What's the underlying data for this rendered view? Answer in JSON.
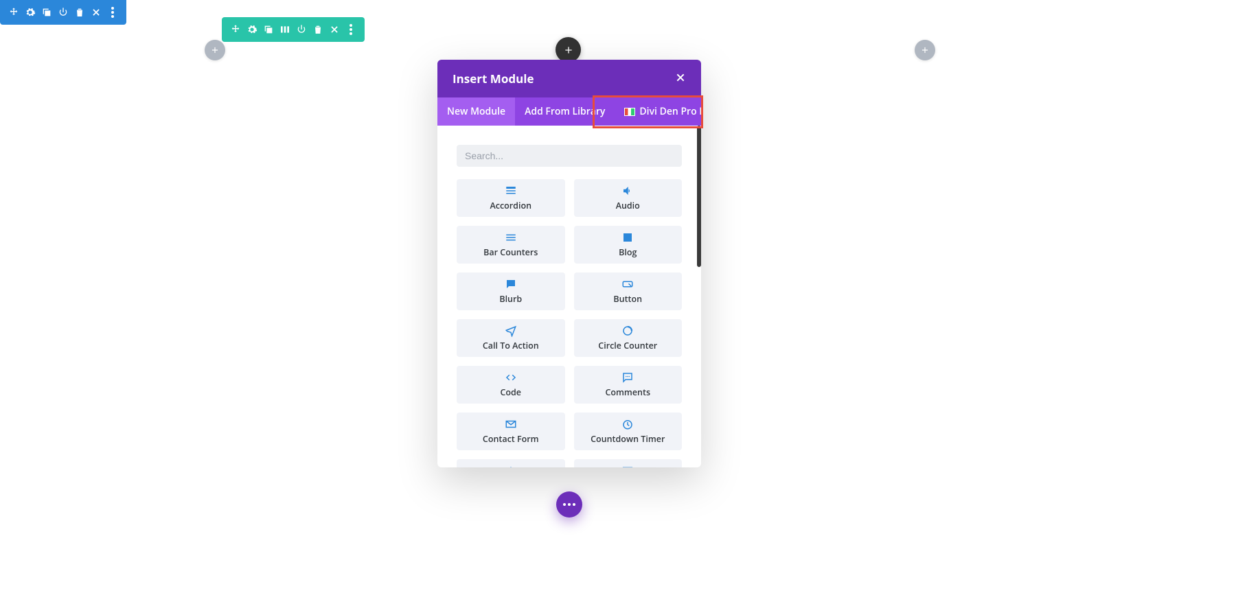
{
  "modal": {
    "title": "Insert Module",
    "tabs": [
      "New Module",
      "Add From Library",
      "Divi Den Pro DM"
    ],
    "activeTabIndex": 0,
    "highlightedTabIndex": 2,
    "search_placeholder": "Search...",
    "modules": [
      {
        "label": "Accordion",
        "icon": "accordion"
      },
      {
        "label": "Audio",
        "icon": "audio"
      },
      {
        "label": "Bar Counters",
        "icon": "bars"
      },
      {
        "label": "Blog",
        "icon": "blog"
      },
      {
        "label": "Blurb",
        "icon": "blurb"
      },
      {
        "label": "Button",
        "icon": "button"
      },
      {
        "label": "Call To Action",
        "icon": "cta"
      },
      {
        "label": "Circle Counter",
        "icon": "circle"
      },
      {
        "label": "Code",
        "icon": "code"
      },
      {
        "label": "Comments",
        "icon": "comments"
      },
      {
        "label": "Contact Form",
        "icon": "mail"
      },
      {
        "label": "Countdown Timer",
        "icon": "timer"
      },
      {
        "label": "",
        "icon": "plus"
      },
      {
        "label": "",
        "icon": "mail"
      }
    ]
  },
  "colors": {
    "section": "#2b87da",
    "row": "#29c4a9",
    "modal_header": "#6c2eb9",
    "modal_tabs": "#8e44e3",
    "highlight": "#e74c3c"
  }
}
